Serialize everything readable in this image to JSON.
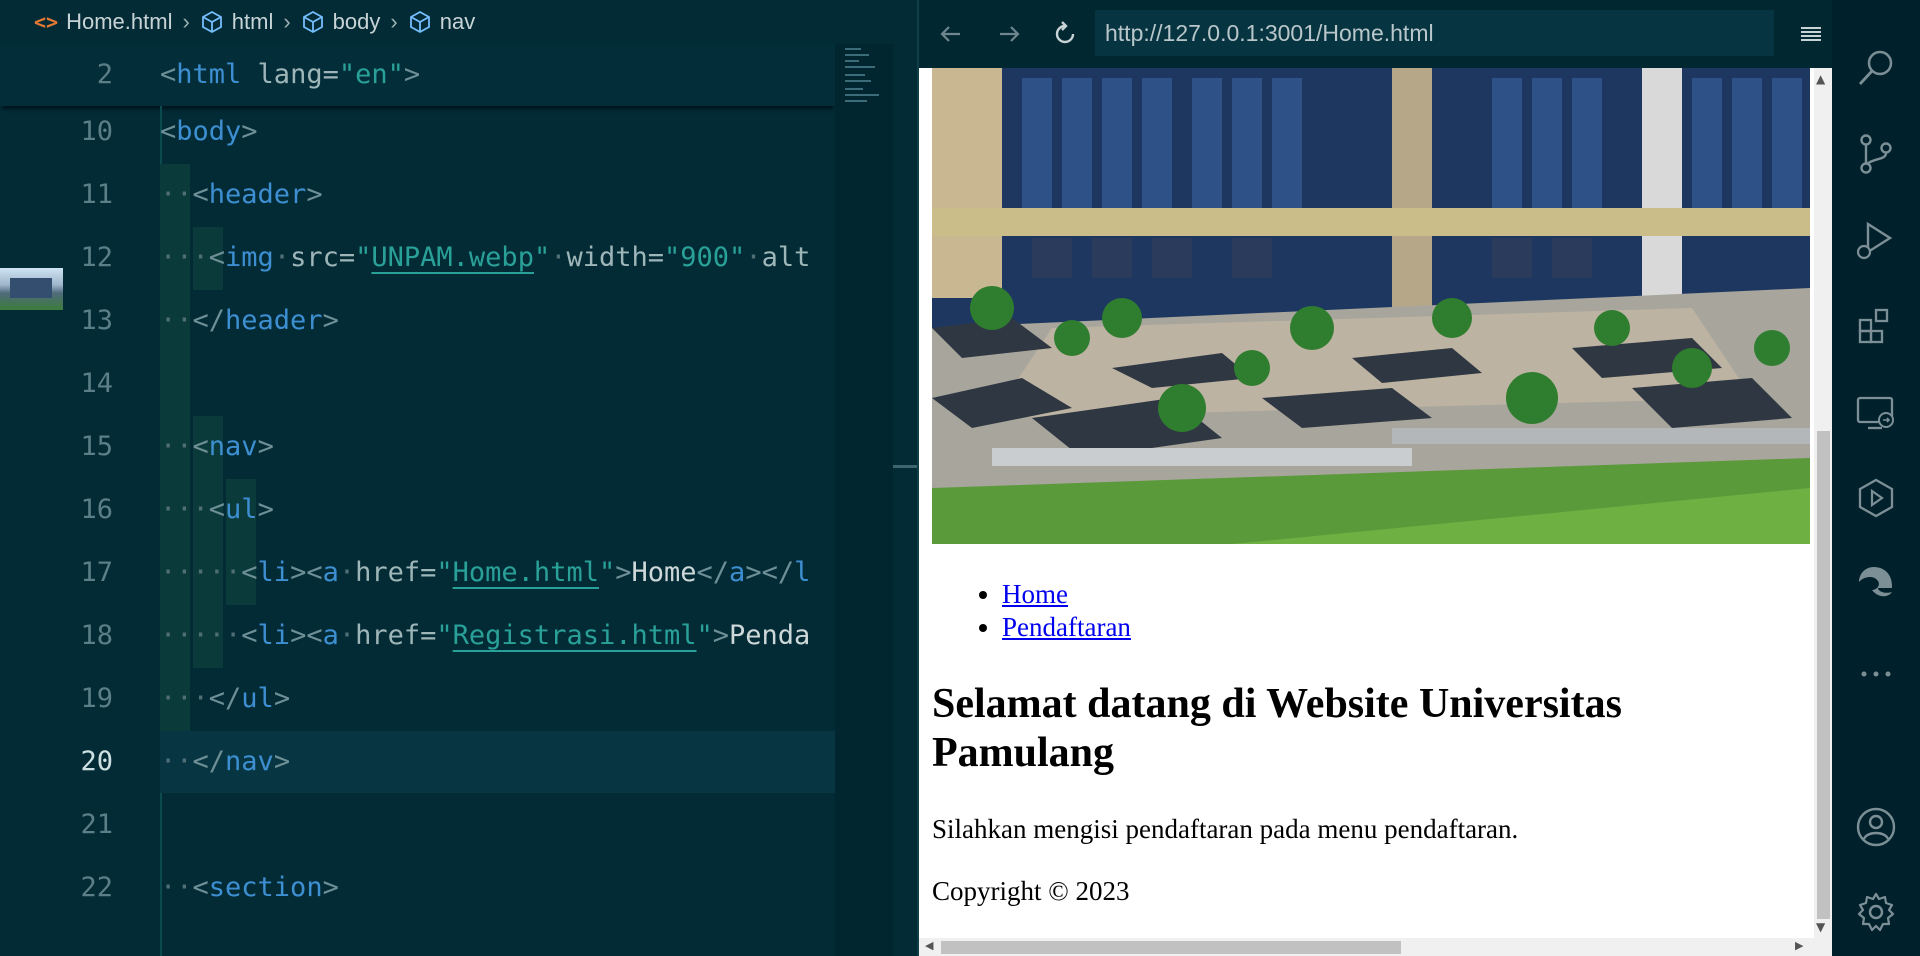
{
  "editor": {
    "breadcrumb": [
      "Home.html",
      "html",
      "body",
      "nav"
    ],
    "lines": [
      {
        "n": "2",
        "sticky": true,
        "tokens": [
          [
            "punc",
            "<"
          ],
          [
            "tag",
            "html"
          ],
          [
            "attr",
            " lang="
          ],
          [
            "str",
            "\"en\""
          ],
          [
            "punc",
            ">"
          ]
        ]
      },
      {
        "n": "10",
        "tokens": [
          [
            "punc",
            "<"
          ],
          [
            "tag",
            "body"
          ],
          [
            "punc",
            ">"
          ]
        ]
      },
      {
        "n": "11",
        "tokens": [
          [
            "dot",
            "··"
          ],
          [
            "punc",
            "<"
          ],
          [
            "tag",
            "header"
          ],
          [
            "punc",
            ">"
          ]
        ]
      },
      {
        "n": "12",
        "tokens": [
          [
            "dot",
            "···"
          ],
          [
            "punc",
            "<"
          ],
          [
            "tag",
            "img"
          ],
          [
            "dot",
            "·"
          ],
          [
            "attr",
            "src="
          ],
          [
            "str",
            "\""
          ],
          [
            "link",
            "UNPAM.webp"
          ],
          [
            "str",
            "\""
          ],
          [
            "dot",
            "·"
          ],
          [
            "attr",
            "width="
          ],
          [
            "str",
            "\"900\""
          ],
          [
            "dot",
            "·"
          ],
          [
            "attr",
            "alt"
          ]
        ]
      },
      {
        "n": "13",
        "tokens": [
          [
            "dot",
            "··"
          ],
          [
            "punc",
            "</"
          ],
          [
            "tag",
            "header"
          ],
          [
            "punc",
            ">"
          ]
        ]
      },
      {
        "n": "14",
        "tokens": []
      },
      {
        "n": "15",
        "tokens": [
          [
            "dot",
            "··"
          ],
          [
            "punc",
            "<"
          ],
          [
            "tag",
            "nav"
          ],
          [
            "punc",
            ">"
          ]
        ]
      },
      {
        "n": "16",
        "tokens": [
          [
            "dot",
            "···"
          ],
          [
            "punc",
            "<"
          ],
          [
            "tag",
            "ul"
          ],
          [
            "punc",
            ">"
          ]
        ]
      },
      {
        "n": "17",
        "tokens": [
          [
            "dot",
            "·····"
          ],
          [
            "punc",
            "<"
          ],
          [
            "tag",
            "li"
          ],
          [
            "punc",
            "><"
          ],
          [
            "tag",
            "a"
          ],
          [
            "dot",
            "·"
          ],
          [
            "attr",
            "href="
          ],
          [
            "str",
            "\""
          ],
          [
            "link",
            "Home.html"
          ],
          [
            "str",
            "\""
          ],
          [
            "punc",
            ">"
          ],
          [
            "txt",
            "Home"
          ],
          [
            "punc",
            "</"
          ],
          [
            "tag",
            "a"
          ],
          [
            "punc",
            "></"
          ],
          [
            "tag",
            "l"
          ]
        ]
      },
      {
        "n": "18",
        "tokens": [
          [
            "dot",
            "·····"
          ],
          [
            "punc",
            "<"
          ],
          [
            "tag",
            "li"
          ],
          [
            "punc",
            "><"
          ],
          [
            "tag",
            "a"
          ],
          [
            "dot",
            "·"
          ],
          [
            "attr",
            "href="
          ],
          [
            "str",
            "\""
          ],
          [
            "link",
            "Registrasi.html"
          ],
          [
            "str",
            "\""
          ],
          [
            "punc",
            ">"
          ],
          [
            "txt",
            "Penda"
          ]
        ]
      },
      {
        "n": "19",
        "tokens": [
          [
            "dot",
            "···"
          ],
          [
            "punc",
            "</"
          ],
          [
            "tag",
            "ul"
          ],
          [
            "punc",
            ">"
          ]
        ]
      },
      {
        "n": "20",
        "active": true,
        "tokens": [
          [
            "dot",
            "··"
          ],
          [
            "punc",
            "</"
          ],
          [
            "tag",
            "nav"
          ],
          [
            "punc",
            ">"
          ]
        ]
      },
      {
        "n": "21",
        "tokens": []
      },
      {
        "n": "22",
        "tokens": [
          [
            "dot",
            "··"
          ],
          [
            "punc",
            "<"
          ],
          [
            "tag",
            "section"
          ],
          [
            "punc",
            ">"
          ]
        ]
      }
    ]
  },
  "browser": {
    "url": "http://127.0.0.1:3001/Home.html",
    "nav_links": [
      "Home",
      "Pendaftaran"
    ],
    "heading": "Selamat datang di Website Universitas Pamulang",
    "description": "Silahkan mengisi pendaftaran pada menu pendaftaran.",
    "copyright": "Copyright © 2023"
  },
  "activity_bar": [
    "search-icon",
    "source-control-icon",
    "run-debug-icon",
    "extensions-icon",
    "remote-explorer-icon",
    "deploy-icon",
    "edge-icon",
    "more-icon",
    "account-icon",
    "settings-icon"
  ]
}
